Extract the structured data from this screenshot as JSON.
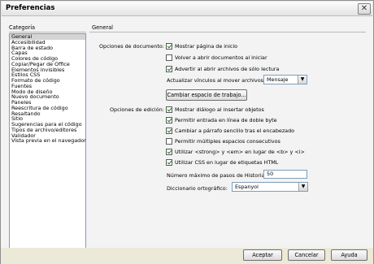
{
  "window": {
    "title": "Preferencias",
    "close_glyph": "✕"
  },
  "categories": {
    "header": "Categoría",
    "items": [
      "General",
      "Accesibilidad",
      "Barra de estado",
      "Capas",
      "Colores de código",
      "Copiar/Pegar de Office",
      "Elementos invisibles",
      "Estilos CSS",
      "Formato de código",
      "Fuentes",
      "Modo de diseño",
      "Nuevo documento",
      "Paneles",
      "Reescritura de código",
      "Resaltando",
      "Sitio",
      "Sugerencias para el código",
      "Tipos de archivo/editores",
      "Validador",
      "Vista previa en el navegador"
    ],
    "selected_index": 0
  },
  "general": {
    "header": "General",
    "doc_options_label": "Opciones de documento:",
    "doc_options": [
      {
        "label": "Mostrar página de inicio",
        "checked": true
      },
      {
        "label": "Volver a abrir documentos al iniciar",
        "checked": false
      },
      {
        "label": "Advertir al abrir archivos de sólo lectura",
        "checked": true
      }
    ],
    "update_links_label": "Actualizar vínculos al mover archivos:",
    "update_links_value": "Mensaje",
    "change_workspace_button": "Cambiar espacio de trabajo...",
    "edit_options_label": "Opciones de edición:",
    "edit_options": [
      {
        "label": "Mostrar diálogo al insertar objetos",
        "checked": true
      },
      {
        "label": "Permitir entrada en línea de doble byte",
        "checked": true
      },
      {
        "label": "Cambiar a párrafo sencillo tras el encabezado",
        "checked": true
      },
      {
        "label": "Permitir múltiples espacios consecutivos",
        "checked": false
      },
      {
        "label": "Utilizar <strong> y <em> en lugar de <b> y <i>",
        "checked": true
      },
      {
        "label": "Utilizar CSS en lugar de etiquetas HTML",
        "checked": true
      }
    ],
    "history_steps_label": "Número máximo de pasos de Historial:",
    "history_steps_value": "50",
    "spell_dict_label": "Diccionario ortográfico:",
    "spell_dict_value": "Espanyol"
  },
  "footer": {
    "ok": "Aceptar",
    "cancel": "Cancelar",
    "help": "Ayuda"
  }
}
